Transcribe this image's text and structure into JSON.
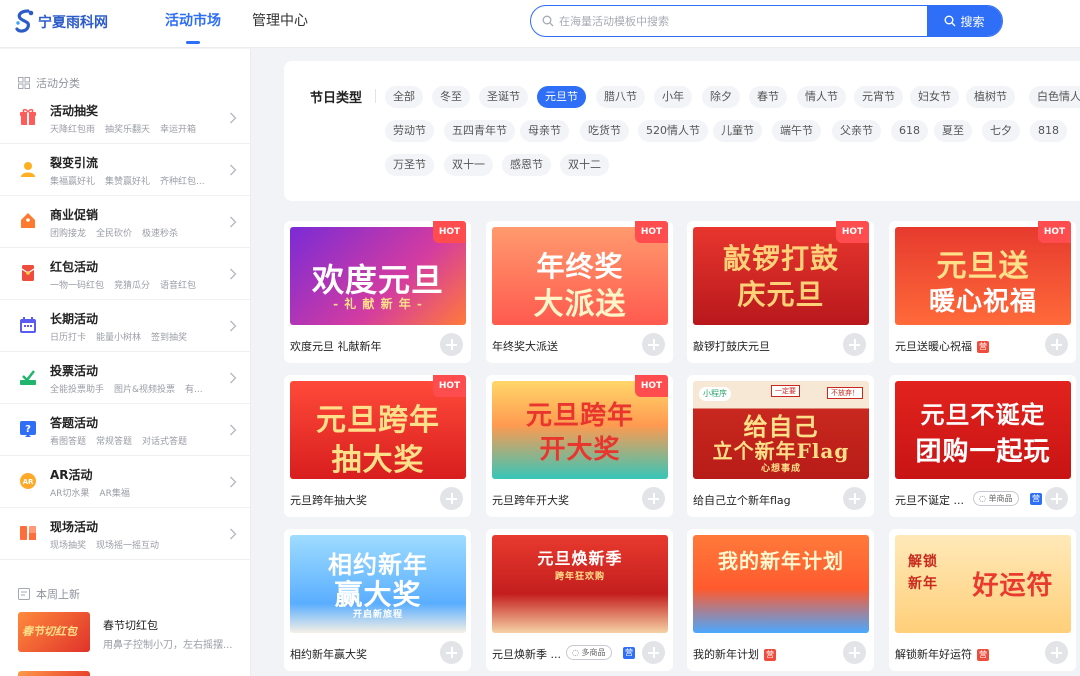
{
  "header": {
    "logo_text": "宁夏雨科网",
    "nav": [
      "活动市场",
      "管理中心"
    ],
    "search_placeholder": "在海量活动模板中搜索",
    "search_button": "搜索"
  },
  "sidebar": {
    "section_title": "活动分类",
    "categories": [
      {
        "title": "活动抽奖",
        "subs": [
          "天降红包雨",
          "抽奖乐翻天",
          "幸运开箱"
        ],
        "icon": "gift-icon",
        "color": "#ff5b5b"
      },
      {
        "title": "裂变引流",
        "subs": [
          "集福赢好礼",
          "集赞赢好礼",
          "齐种红包..."
        ],
        "icon": "users-icon",
        "color": "#ffb020"
      },
      {
        "title": "商业促销",
        "subs": [
          "团购接龙",
          "全民砍价",
          "极速秒杀"
        ],
        "icon": "price-tag-icon",
        "color": "#ff7a2f"
      },
      {
        "title": "红包活动",
        "subs": [
          "一物一码红包",
          "竞猜瓜分",
          "语音红包"
        ],
        "icon": "red-envelope-icon",
        "color": "#f04c3e"
      },
      {
        "title": "长期活动",
        "subs": [
          "日历打卡",
          "能量小树林",
          "签到抽奖"
        ],
        "icon": "calendar-icon",
        "color": "#5a5cf0"
      },
      {
        "title": "投票活动",
        "subs": [
          "全能投票助手",
          "图片&视频投票",
          "有..."
        ],
        "icon": "vote-icon",
        "color": "#1fb56b"
      },
      {
        "title": "答题活动",
        "subs": [
          "看图答题",
          "常规答题",
          "对话式答题"
        ],
        "icon": "question-icon",
        "color": "#2f6ef6"
      },
      {
        "title": "AR活动",
        "subs": [
          "AR切水果",
          "AR集福"
        ],
        "icon": "ar-icon",
        "color": "#ffa928"
      },
      {
        "title": "现场活动",
        "subs": [
          "现场抽奖",
          "现场摇一摇互动"
        ],
        "icon": "stage-icon",
        "color": "#ff6d3b"
      }
    ],
    "weekly_title": "本周上新",
    "new_item": {
      "thumb_text": "春节切红包",
      "title": "春节切红包",
      "desc": "用鼻子控制小刀，左右摇摆..."
    }
  },
  "filter": {
    "label": "节日类型",
    "tags": [
      "全部",
      "冬至",
      "圣诞节",
      "元旦节",
      "腊八节",
      "小年",
      "除夕",
      "春节",
      "情人节",
      "元宵节",
      "妇女节",
      "植树节",
      "白色情人节",
      "劳动节",
      "五四青年节",
      "母亲节",
      "吃货节",
      "520情人节",
      "儿童节",
      "端午节",
      "父亲节",
      "618",
      "夏至",
      "七夕",
      "818",
      "万圣节",
      "双十一",
      "感恩节",
      "双十二"
    ],
    "active": "元旦节"
  },
  "cards": [
    {
      "title": "欢度元旦 礼献新年",
      "thumb": "欢度元旦",
      "thumb_sub": "- 礼 献 新 年 -",
      "hot": "HOT"
    },
    {
      "title": "年终奖大派送",
      "thumb": "年终奖",
      "thumb2": "大派送",
      "hot": "HOT"
    },
    {
      "title": "敲锣打鼓庆元旦",
      "thumb": "敲锣打鼓",
      "thumb2": "庆元旦",
      "hot": "HOT"
    },
    {
      "title": "元旦送暖心祝福",
      "thumb": "元旦送",
      "thumb2": "暖心祝福",
      "hot": "HOT",
      "badge": "营"
    },
    {
      "title": "元旦跨年抽大奖",
      "thumb": "元旦跨年",
      "thumb2": "抽大奖",
      "hot": "HOT"
    },
    {
      "title": "元旦跨年开大奖",
      "thumb": "元旦跨年",
      "thumb2": "开大奖",
      "hot": "HOT"
    },
    {
      "title": "给自己立个新年flag",
      "thumb": "给自己",
      "thumb2": "立个新年Flag",
      "thumb_sub": "心想事成",
      "mini": "小程序",
      "mini_tag": "不放弃！",
      "mini_tag2": "一定要"
    },
    {
      "title": "元旦不诞定 ...",
      "thumb": "元旦不诞定",
      "thumb2": "团购一起玩",
      "product": "单商品",
      "badge": "营"
    },
    {
      "title": "相约新年赢大奖",
      "thumb": "相约新年",
      "thumb2": "赢大奖",
      "thumb_sub": "开启新旅程"
    },
    {
      "title": "元旦焕新季 ...",
      "thumb": "元旦焕新季",
      "thumb_sub": "跨年狂欢购",
      "product": "多商品",
      "badge": "营"
    },
    {
      "title": "我的新年计划",
      "thumb": "我的新年计划",
      "badge": "营"
    },
    {
      "title": "解锁新年好运符",
      "thumb": "解锁",
      "thumb2": "新年",
      "thumb3": "好运符",
      "badge": "营"
    }
  ]
}
